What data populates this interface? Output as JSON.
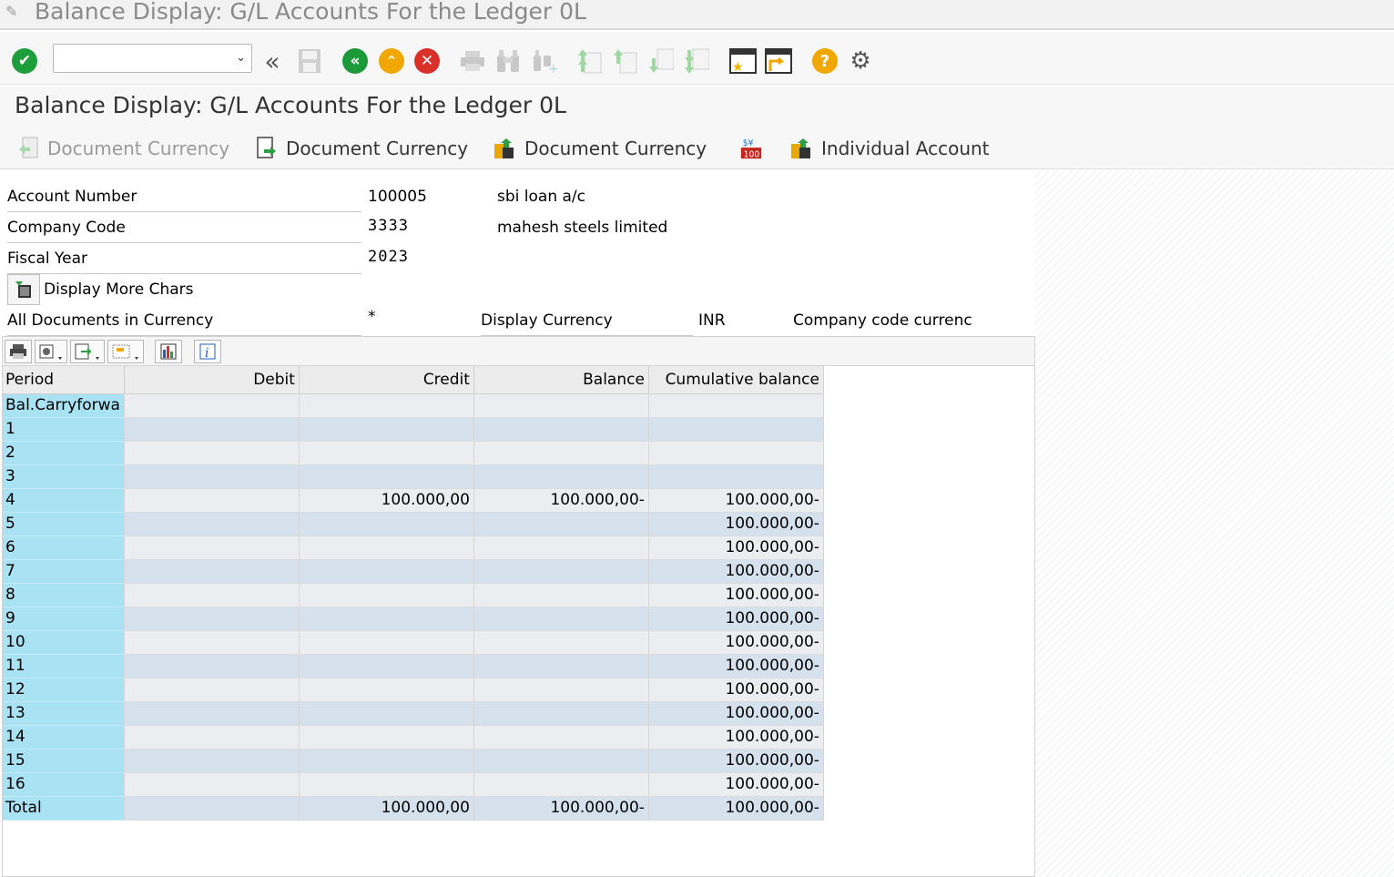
{
  "window": {
    "title": "Balance Display: G/L Accounts For the Ledger 0L"
  },
  "toolbar": {
    "command_value": "",
    "icons": [
      "enter-icon",
      "back-double-icon",
      "save-icon",
      "back-icon",
      "exit-icon",
      "cancel-icon",
      "print-icon",
      "find-icon",
      "find-next-icon",
      "first-page-icon",
      "previous-page-icon",
      "next-page-icon",
      "last-page-icon",
      "create-session-icon",
      "shortcut-icon",
      "help-icon",
      "settings-icon"
    ]
  },
  "page": {
    "title": "Balance Display: G/L Accounts For the Ledger 0L"
  },
  "app_toolbar": {
    "btn1": "Document Currency",
    "btn2": "Document Currency",
    "btn3": "Document Currency",
    "btn4": "Individual Account"
  },
  "header": {
    "account_number_label": "Account Number",
    "account_number": "100005",
    "account_name": "sbi loan a/c",
    "company_code_label": "Company Code",
    "company_code": "3333",
    "company_name": "mahesh steels limited",
    "fiscal_year_label": "Fiscal Year",
    "fiscal_year": "2023",
    "display_more_label": "Display More Chars",
    "all_docs_label": "All Documents in Currency",
    "all_docs_value": "*",
    "display_currency_label": "Display Currency",
    "display_currency_value": "INR",
    "currency_type_label": "Company code currenc"
  },
  "grid": {
    "columns": [
      "Period",
      "Debit",
      "Credit",
      "Balance",
      "Cumulative balance"
    ],
    "rows": [
      [
        "Bal.Carryforwa",
        "",
        "",
        "",
        ""
      ],
      [
        "1",
        "",
        "",
        "",
        ""
      ],
      [
        "2",
        "",
        "",
        "",
        ""
      ],
      [
        "3",
        "",
        "",
        "",
        ""
      ],
      [
        "4",
        "",
        "100.000,00",
        "100.000,00-",
        "100.000,00-"
      ],
      [
        "5",
        "",
        "",
        "",
        "100.000,00-"
      ],
      [
        "6",
        "",
        "",
        "",
        "100.000,00-"
      ],
      [
        "7",
        "",
        "",
        "",
        "100.000,00-"
      ],
      [
        "8",
        "",
        "",
        "",
        "100.000,00-"
      ],
      [
        "9",
        "",
        "",
        "",
        "100.000,00-"
      ],
      [
        "10",
        "",
        "",
        "",
        "100.000,00-"
      ],
      [
        "11",
        "",
        "",
        "",
        "100.000,00-"
      ],
      [
        "12",
        "",
        "",
        "",
        "100.000,00-"
      ],
      [
        "13",
        "",
        "",
        "",
        "100.000,00-"
      ],
      [
        "14",
        "",
        "",
        "",
        "100.000,00-"
      ],
      [
        "15",
        "",
        "",
        "",
        "100.000,00-"
      ],
      [
        "16",
        "",
        "",
        "",
        "100.000,00-"
      ],
      [
        "Total",
        "",
        "100.000,00",
        "100.000,00-",
        "100.000,00-"
      ]
    ]
  },
  "colors": {
    "period_bg": "#a9e2f3",
    "row_odd": "#ebedf0",
    "row_even": "#d6e1ee",
    "enter_green": "#1e9e3a",
    "back_green": "#1c9a3a",
    "exit_orange": "#f0a800",
    "cancel_red": "#d9302a",
    "help_orange": "#f0a800"
  }
}
